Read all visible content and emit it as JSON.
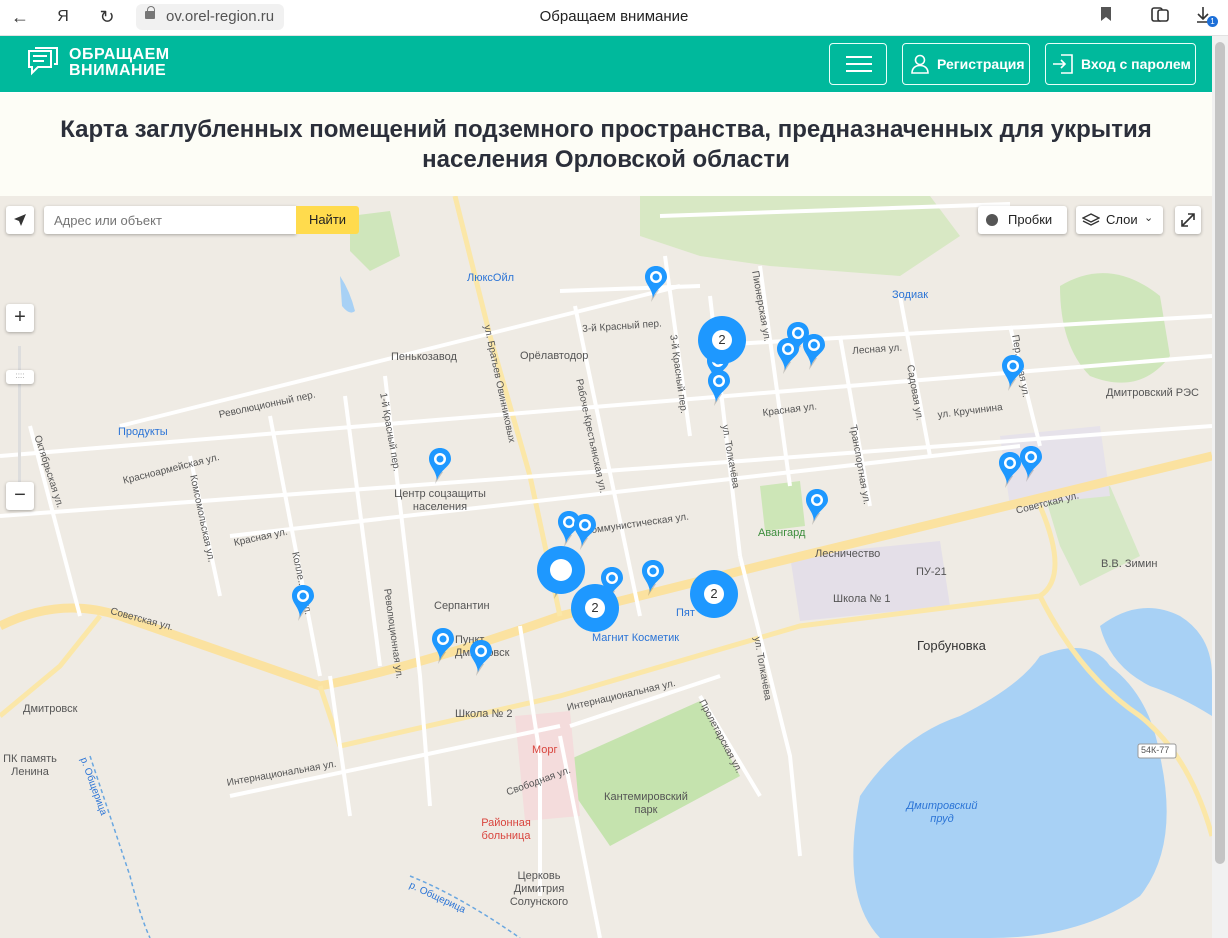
{
  "browser": {
    "url": "ov.orel-region.ru",
    "tab_title": "Обращаем внимание",
    "download_count": "1"
  },
  "site": {
    "logo_line1": "ОБРАЩАЕМ",
    "logo_line2": "ВНИМАНИЕ",
    "register_label": "Регистрация",
    "login_label": "Вход с паролем"
  },
  "page": {
    "title": "Карта заглубленных помещений подземного пространства, предназначенных для укрытия населения Орловской области"
  },
  "map": {
    "search_placeholder": "Адрес или объект",
    "search_button": "Найти",
    "traffic_label": "Пробки",
    "layers_label": "Слои",
    "zoom_in": "+",
    "zoom_out": "−",
    "clusters": [
      {
        "count": "2"
      },
      {
        "count": "2"
      },
      {
        "count": "2"
      }
    ],
    "places": {
      "lyuksoil": "ЛюксОйл",
      "zodiak": "Зодиак",
      "penkozavod": "Пенькозавод",
      "orelavtodor": "Орёлавтодор",
      "dmitrovsky_res": "Дмитровский РЭС",
      "produkty": "Продукты",
      "center_soc": "Центр соцзащиты населения",
      "avangard": "Авангард",
      "lesnichestvo": "Лесничество",
      "pu21": "ПУ-21",
      "school1": "Школа № 1",
      "vv_zimin": "В.В. Зимин",
      "serpantin": "Серпантин",
      "magnit": "Магнит Косметик",
      "pyat": "Пят",
      "gorbunovka": "Горбуновка",
      "dmitrovsk": "Дмитровск",
      "pamyat": "ПК память Ленина",
      "punkt": "Пункт Дмитровск",
      "school2": "Школа № 2",
      "morg": "Морг",
      "park": "Кантемировский парк",
      "hospital": "Районная больница",
      "church": "Церковь Димитрия Солунского",
      "pond": "Дмитровский пруд",
      "road_badge": "54К-77",
      "river1": "р. Общерица",
      "river2": "р. Общерица"
    },
    "streets": {
      "s1": "ул. Братьев Овинниковых",
      "s2": "3-й Красный пер.",
      "s3": "3-й Красный пер.",
      "s4": "Пионерская ул.",
      "s5": "Лесная ул.",
      "s6": "Садовая ул.",
      "s7": "Пер...ская ул.",
      "s8": "ул. Кручинина",
      "s9": "Красная ул.",
      "s10": "Рабоче-Крестьянская ул.",
      "s11": "ул. Толкачёва",
      "s12": "Транспортная ул.",
      "s13": "Революционный пер.",
      "s14": "1-й Красный пер.",
      "s15": "Октябрьская ул.",
      "s16": "Красноармейская ул.",
      "s17": "Комсомольская ул.",
      "s18": "Красная ул.",
      "s19": "Коммунистическая ул.",
      "s20": "Советская ул.",
      "s21": "Советская ул.",
      "s22": "Колле...ая ул.",
      "s23": "Революционная ул.",
      "s24": "Интернациональная ул.",
      "s25": "Интернациональная ул.",
      "s26": "Свободная ул.",
      "s27": "Пролетарская ул.",
      "s28": "ул. Толкачёва"
    }
  }
}
